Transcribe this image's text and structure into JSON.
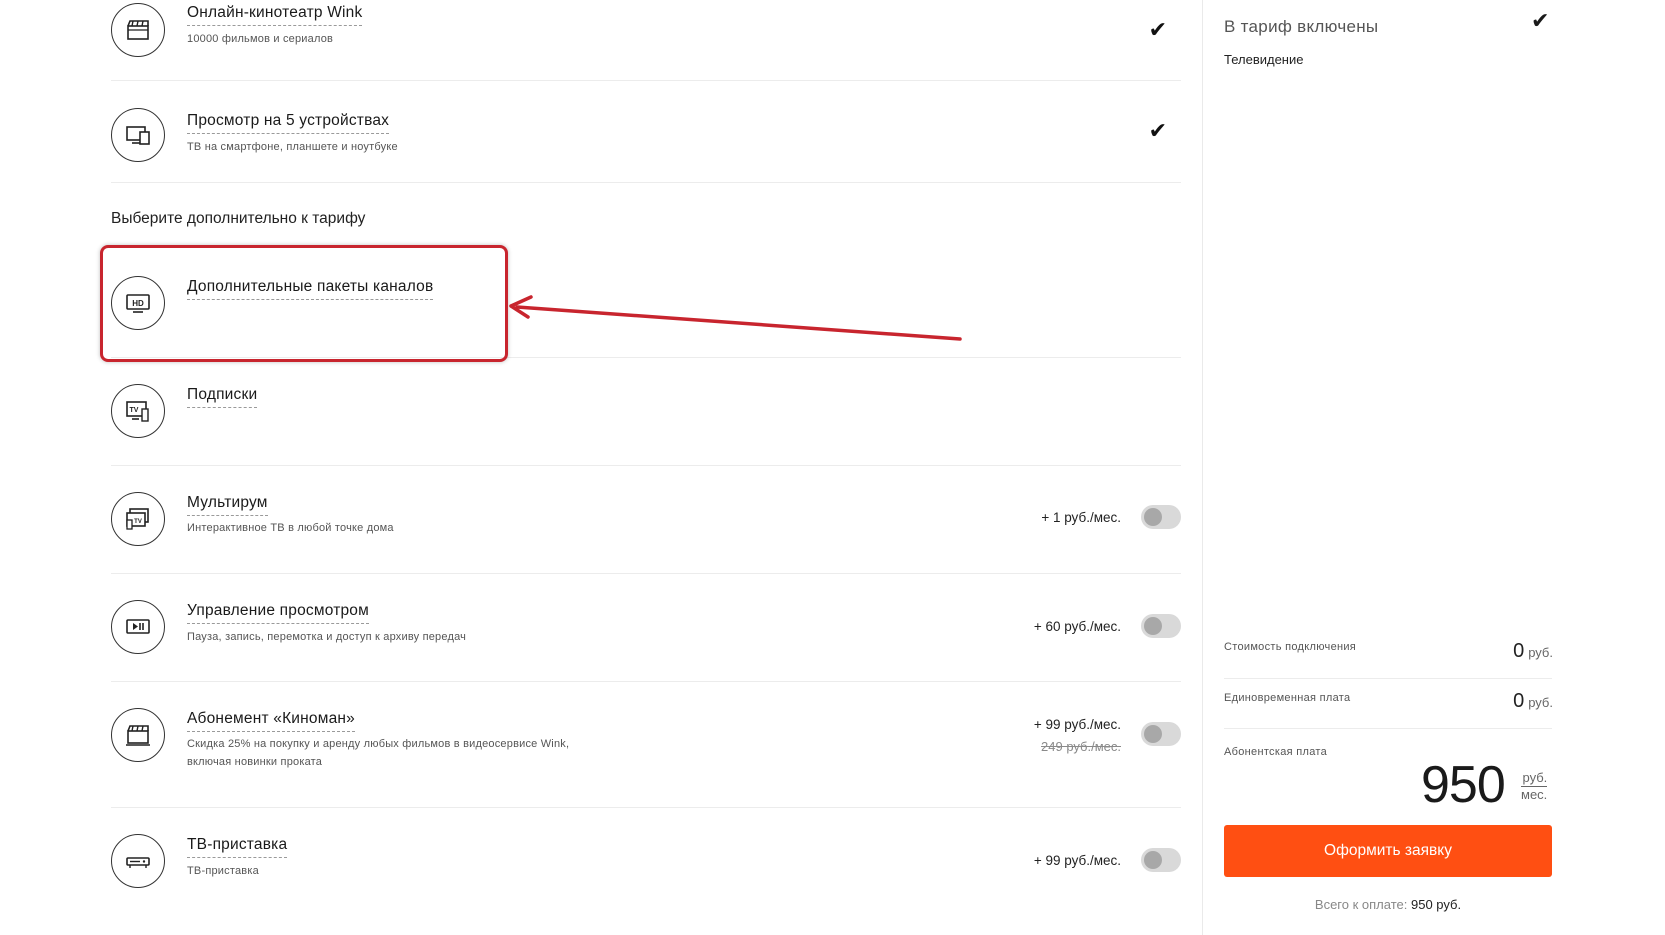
{
  "features_included": [
    {
      "title": "Онлайн-кинотеатр Wink",
      "subtitle": "10000 фильмов и сериалов",
      "icon": "clapperboard-icon"
    },
    {
      "title": "Просмотр на 5 устройствах",
      "subtitle": "ТВ на смартфоне, планшете и ноутбуке",
      "icon": "devices-icon"
    }
  ],
  "section_heading": "Выберите дополнительно к тарифу",
  "extras": [
    {
      "title": "Дополнительные пакеты каналов",
      "icon": "hd-tv-icon"
    },
    {
      "title": "Подписки",
      "icon": "tv-remote-icon"
    },
    {
      "title": "Мультирум",
      "subtitle": "Интерактивное ТВ в любой точке дома",
      "price": "+ 1 руб./мес.",
      "icon": "multiroom-icon",
      "enabled": false
    },
    {
      "title": "Управление просмотром",
      "subtitle": "Пауза, запись, перемотка и доступ к архиву передач",
      "price": "+ 60 руб./мес.",
      "icon": "play-pause-icon",
      "enabled": false
    },
    {
      "title": "Абонемент «Киноман»",
      "subtitle": "Скидка 25% на покупку и аренду любых фильмов в видеосервисе Wink,",
      "subtitle2": "включая новинки проката",
      "price": "+ 99 руб./мес.",
      "old_price": "249 руб./мес.",
      "icon": "cinema-icon",
      "enabled": false
    },
    {
      "title": "ТВ-приставка",
      "subtitle": "ТВ-приставка",
      "price": "+ 99 руб./мес.",
      "icon": "set-top-box-icon",
      "enabled": false
    }
  ],
  "sidebar": {
    "heading": "В тариф включены",
    "included_item": "Телевидение",
    "connection_label": "Стоимость подключения",
    "connection_value": "0",
    "one_time_label": "Единовременная плата",
    "one_time_value": "0",
    "currency": "руб.",
    "monthly_label": "Абонентская плата",
    "monthly_value": "950",
    "monthly_unit_top": "руб.",
    "monthly_unit_bottom": "мес.",
    "order_button": "Оформить заявку",
    "total_label": "Всего к оплате:",
    "total_value": "950 руб."
  },
  "colors": {
    "accent_button": "#ff4f12",
    "highlight_box": "#c8252e"
  }
}
